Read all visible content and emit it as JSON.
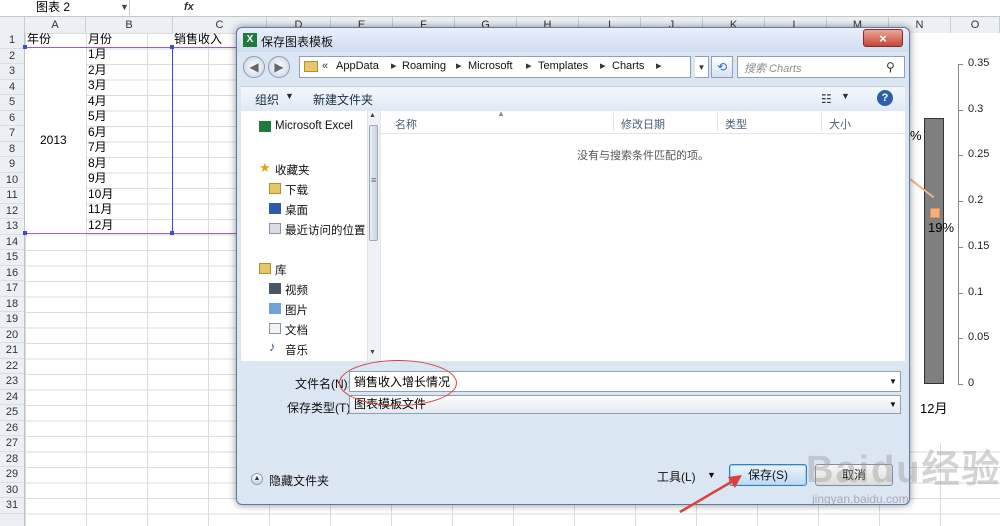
{
  "excel": {
    "name_box": "图表 2",
    "fx": "fx",
    "columns": [
      "A",
      "B",
      "C",
      "D",
      "E",
      "F",
      "G",
      "H",
      "I",
      "J",
      "K",
      "L",
      "M",
      "N",
      "O"
    ],
    "rows": [
      "1",
      "2",
      "3",
      "4",
      "5",
      "6",
      "7",
      "8",
      "9",
      "10",
      "11",
      "12",
      "13",
      "14",
      "15",
      "16",
      "17",
      "18",
      "19",
      "20",
      "21",
      "22",
      "23",
      "24",
      "25",
      "26",
      "27",
      "28",
      "29",
      "30",
      "31"
    ],
    "header_year": "年份",
    "header_month": "月份",
    "header_sales": "销售收入",
    "year_value": "2013",
    "months": [
      "1月",
      "2月",
      "3月",
      "4月",
      "5月",
      "6月",
      "7月",
      "8月",
      "9月",
      "10月",
      "11月",
      "12月"
    ]
  },
  "chart": {
    "y_ticks": [
      "0.35",
      "0.3",
      "0.25",
      "0.2",
      "0.15",
      "0.1",
      "0.05",
      "0"
    ],
    "data_label_19": "19%",
    "data_label_pct": "%",
    "x_label": "12月"
  },
  "dialog": {
    "title": "保存图表模板",
    "close": "×",
    "address": {
      "root": "«",
      "crumbs": [
        "AppData",
        "Roaming",
        "Microsoft",
        "Templates",
        "Charts"
      ]
    },
    "search_placeholder": "搜索 Charts",
    "toolbar": {
      "organize": "组织",
      "new_folder": "新建文件夹"
    },
    "nav": {
      "microsoft_excel": "Microsoft Excel",
      "favorites": "收藏夹",
      "downloads": "下载",
      "desktop": "桌面",
      "recent": "最近访问的位置",
      "libraries": "库",
      "videos": "视频",
      "pictures": "图片",
      "documents": "文档",
      "music": "音乐"
    },
    "columns": {
      "name": "名称",
      "date": "修改日期",
      "type": "类型",
      "size": "大小"
    },
    "empty_message": "没有与搜索条件匹配的项。",
    "filename_label": "文件名(N):",
    "filename_value": "销售收入增长情况",
    "filetype_label": "保存类型(T):",
    "filetype_value": "图表模板文件",
    "hide_folders": "隐藏文件夹",
    "tools": "工具(L)",
    "save": "保存(S)",
    "cancel": "取消"
  },
  "watermark": {
    "logo": "Baidu经验",
    "url": "jingyan.baidu.com"
  },
  "colors": {
    "dialog_bg": "#dbe6f3",
    "annotation": "#d8443c",
    "selection": "#3b4cd6"
  }
}
